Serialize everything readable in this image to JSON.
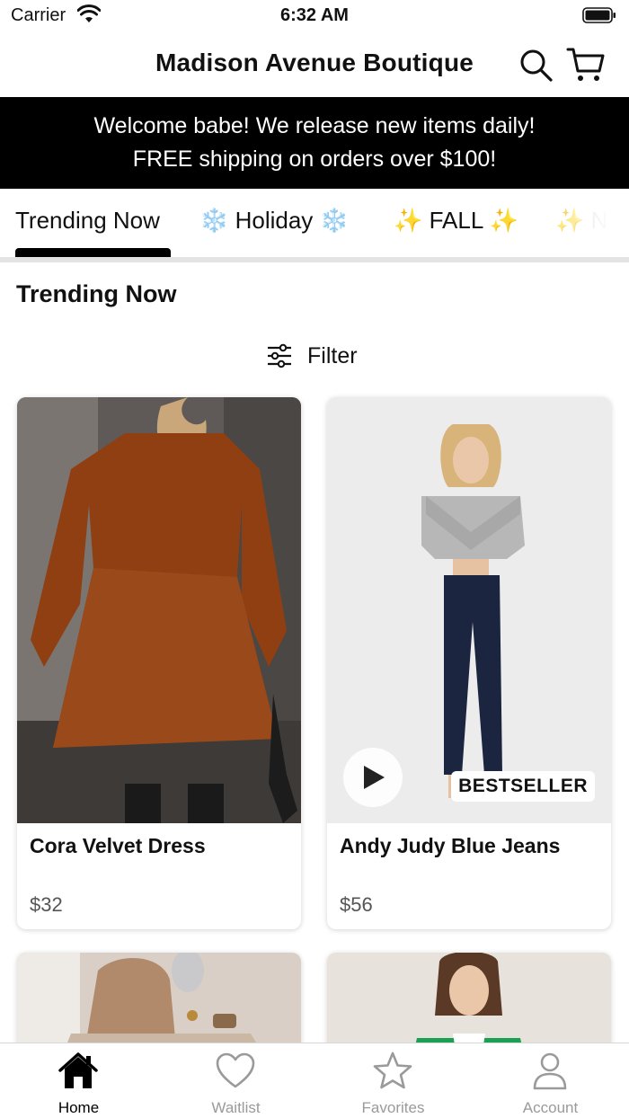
{
  "status_bar": {
    "carrier": "Carrier",
    "time": "6:32 AM"
  },
  "header": {
    "title": "Madison Avenue Boutique",
    "search_icon": "search-icon",
    "cart_icon": "cart-icon"
  },
  "banner": {
    "line1": "Welcome babe! We release new items daily!",
    "line2": "FREE shipping on orders over $100!"
  },
  "category_tabs": [
    {
      "label": "Trending Now",
      "selected": true
    },
    {
      "label": "❄️ Holiday ❄️",
      "selected": false
    },
    {
      "label": "✨ FALL ✨",
      "selected": false
    },
    {
      "label": "✨ N",
      "selected": false
    }
  ],
  "section": {
    "title": "Trending Now",
    "filter_label": "Filter",
    "filter_icon": "sliders-icon"
  },
  "products": [
    {
      "name": "Cora Velvet Dress",
      "price": "$32",
      "badge": "",
      "has_video": false,
      "image_colors": {
        "bg": "#6f6a66",
        "accent": "#9a4a1a"
      }
    },
    {
      "name": "Andy Judy Blue Jeans",
      "price": "$56",
      "badge": "BESTSELLER",
      "has_video": true,
      "image_colors": {
        "bg": "#ececec",
        "accent": "#1c2540"
      }
    },
    {
      "name": "",
      "price": "",
      "badge": "",
      "has_video": false,
      "image_colors": {
        "bg": "#d9cfc6",
        "accent": "#b08a6a"
      }
    },
    {
      "name": "",
      "price": "",
      "badge": "",
      "has_video": false,
      "image_colors": {
        "bg": "#e7e2dc",
        "accent": "#1aa052"
      }
    }
  ],
  "bottom_nav": [
    {
      "label": "Home",
      "icon": "home-icon",
      "active": true
    },
    {
      "label": "Waitlist",
      "icon": "heart-icon",
      "active": false
    },
    {
      "label": "Favorites",
      "icon": "star-icon",
      "active": false
    },
    {
      "label": "Account",
      "icon": "person-icon",
      "active": false
    }
  ],
  "colors": {
    "banner_bg": "#000000",
    "banner_text": "#ffffff",
    "inactive_nav": "#9a9a9a",
    "active_nav": "#000000"
  }
}
